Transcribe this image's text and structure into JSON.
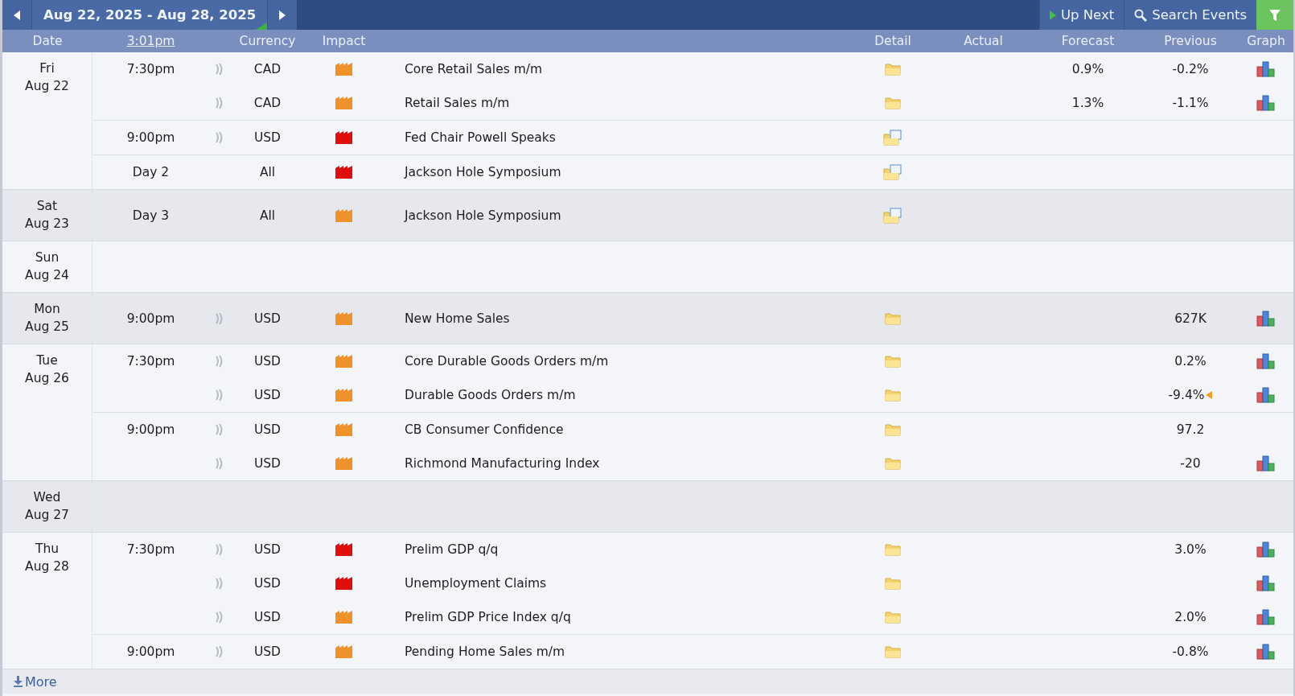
{
  "toolbar": {
    "date_range": "Aug 22, 2025 - Aug 28, 2025",
    "up_next": "Up Next",
    "search": "Search Events"
  },
  "columns": [
    "Date",
    "3:01pm",
    "Currency",
    "Impact",
    "Detail",
    "Actual",
    "Forecast",
    "Previous",
    "Graph"
  ],
  "days": [
    {
      "weekday": "Fri",
      "date": "Aug 22",
      "events": [
        {
          "time": "7:30pm",
          "sound": true,
          "currency": "CAD",
          "color": "#f0922a",
          "title": "Core Retail Sales m/m",
          "speech_doc": false,
          "forecast": "0.9%",
          "previous": "-0.2%",
          "revised": false,
          "graph": true
        },
        {
          "sound": true,
          "currency": "CAD",
          "color": "#f0922a",
          "title": "Retail Sales m/m",
          "speech_doc": false,
          "forecast": "1.3%",
          "previous": "-1.1%",
          "revised": false,
          "graph": true
        },
        {
          "time": "9:00pm",
          "sound": true,
          "currency": "USD",
          "color": "#e00d0d",
          "title": "Fed Chair Powell Speaks",
          "speech_doc": true,
          "revised": false,
          "graph": false
        },
        {
          "time": "Day 2",
          "sound": false,
          "currency": "All",
          "color": "#e00d0d",
          "title": "Jackson Hole Symposium",
          "speech_doc": true,
          "revised": false,
          "graph": false
        }
      ]
    },
    {
      "weekday": "Sat",
      "date": "Aug 23",
      "events": [
        {
          "time": "Day 3",
          "sound": false,
          "currency": "All",
          "color": "#f0922a",
          "title": "Jackson Hole Symposium",
          "speech_doc": true,
          "revised": false,
          "graph": false
        }
      ]
    },
    {
      "weekday": "Sun",
      "date": "Aug 24"
    },
    {
      "weekday": "Mon",
      "date": "Aug 25",
      "events": [
        {
          "time": "9:00pm",
          "sound": true,
          "currency": "USD",
          "color": "#f0922a",
          "title": "New Home Sales",
          "speech_doc": false,
          "previous": "627K",
          "revised": false,
          "graph": true
        }
      ]
    },
    {
      "weekday": "Tue",
      "date": "Aug 26",
      "events": [
        {
          "time": "7:30pm",
          "sound": true,
          "currency": "USD",
          "color": "#f0922a",
          "title": "Core Durable Goods Orders m/m",
          "speech_doc": false,
          "previous": "0.2%",
          "revised": false,
          "graph": true
        },
        {
          "sound": true,
          "currency": "USD",
          "color": "#f0922a",
          "title": "Durable Goods Orders m/m",
          "speech_doc": false,
          "previous": "-9.4%",
          "revised": true,
          "graph": true
        },
        {
          "time": "9:00pm",
          "sound": true,
          "currency": "USD",
          "color": "#f0922a",
          "title": "CB Consumer Confidence",
          "speech_doc": false,
          "previous": "97.2",
          "revised": false,
          "graph": false
        },
        {
          "sound": true,
          "currency": "USD",
          "color": "#f0922a",
          "title": "Richmond Manufacturing Index",
          "speech_doc": false,
          "previous": "-20",
          "revised": false,
          "graph": true
        }
      ]
    },
    {
      "weekday": "Wed",
      "date": "Aug 27"
    },
    {
      "weekday": "Thu",
      "date": "Aug 28",
      "events": [
        {
          "time": "7:30pm",
          "sound": true,
          "currency": "USD",
          "color": "#e00d0d",
          "title": "Prelim GDP q/q",
          "speech_doc": false,
          "previous": "3.0%",
          "revised": false,
          "graph": true
        },
        {
          "sound": true,
          "currency": "USD",
          "color": "#e00d0d",
          "title": "Unemployment Claims",
          "speech_doc": false,
          "revised": false,
          "graph": true
        },
        {
          "sound": true,
          "currency": "USD",
          "color": "#f0922a",
          "title": "Prelim GDP Price Index q/q",
          "speech_doc": false,
          "previous": "2.0%",
          "revised": false,
          "graph": true
        },
        {
          "time": "9:00pm",
          "sound": true,
          "currency": "USD",
          "color": "#f0922a",
          "title": "Pending Home Sales m/m",
          "speech_doc": false,
          "previous": "-0.8%",
          "revised": false,
          "graph": true
        }
      ]
    }
  ],
  "footer": {
    "more": "More"
  }
}
